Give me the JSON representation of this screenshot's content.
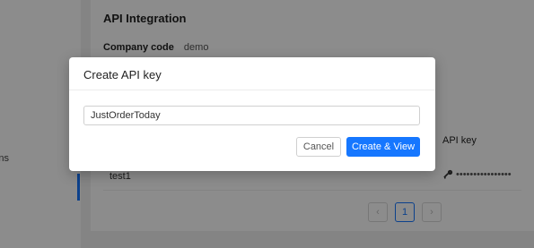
{
  "sidebar": {
    "partial_item_label": "ns"
  },
  "card": {
    "title": "API Integration",
    "company_code_label": "Company code",
    "company_code_value": "demo"
  },
  "table": {
    "header_api_key": "API key",
    "rows": [
      {
        "name": "test1",
        "key_masked": "••••••••••••••••"
      }
    ]
  },
  "pagination": {
    "prev_icon": "‹",
    "current_page": "1",
    "next_icon": "›"
  },
  "modal": {
    "title": "Create API key",
    "input_value": "JustOrderToday",
    "cancel_label": "Cancel",
    "submit_label": "Create & View"
  },
  "colors": {
    "primary": "#1677ff",
    "overlay": "rgba(0,0,0,0.45)"
  }
}
